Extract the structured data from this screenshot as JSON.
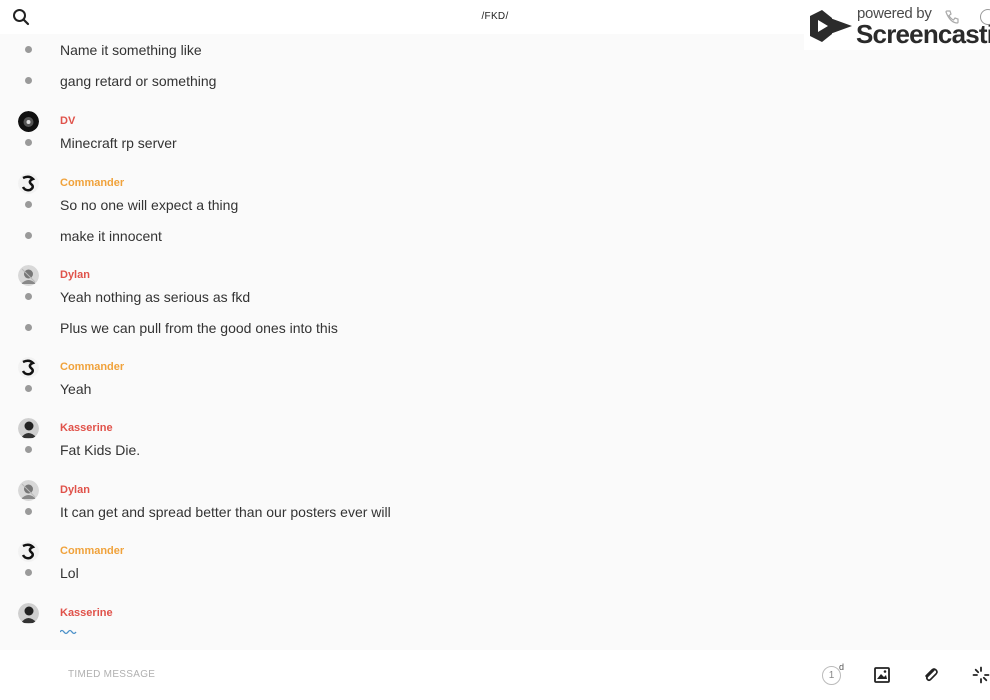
{
  "header": {
    "title": "/FKD/"
  },
  "watermark": {
    "powered_by": "powered by",
    "brand": "Screencastify"
  },
  "colors": {
    "dv": "#e0524a",
    "commander": "#f0a23b",
    "dylan": "#e0524a",
    "kasserine": "#e0524a"
  },
  "messages": [
    {
      "author": "",
      "lines": [
        "Name it something like",
        "gang retard or something"
      ]
    },
    {
      "author": "DV",
      "lines": [
        "Minecraft rp server"
      ]
    },
    {
      "author": "Commander",
      "lines": [
        "So no one will expect a thing",
        "make it innocent"
      ]
    },
    {
      "author": "Dylan",
      "lines": [
        "Yeah nothing as serious as fkd",
        "Plus we can pull from the good ones into this"
      ]
    },
    {
      "author": "Commander",
      "lines": [
        "Yeah"
      ]
    },
    {
      "author": "Kasserine",
      "lines": [
        "Fat Kids Die."
      ]
    },
    {
      "author": "Dylan",
      "lines": [
        "It can get and spread better than our posters ever will"
      ]
    },
    {
      "author": "Commander",
      "lines": [
        "Lol"
      ]
    },
    {
      "author": "Kasserine",
      "lines": []
    }
  ],
  "composer": {
    "placeholder": "TIMED MESSAGE",
    "timer_value": "1",
    "timer_unit": "d"
  },
  "icons": {
    "search": "search-icon",
    "image": "image-icon",
    "attach": "paperclip-icon",
    "more": "spinner-icon"
  }
}
